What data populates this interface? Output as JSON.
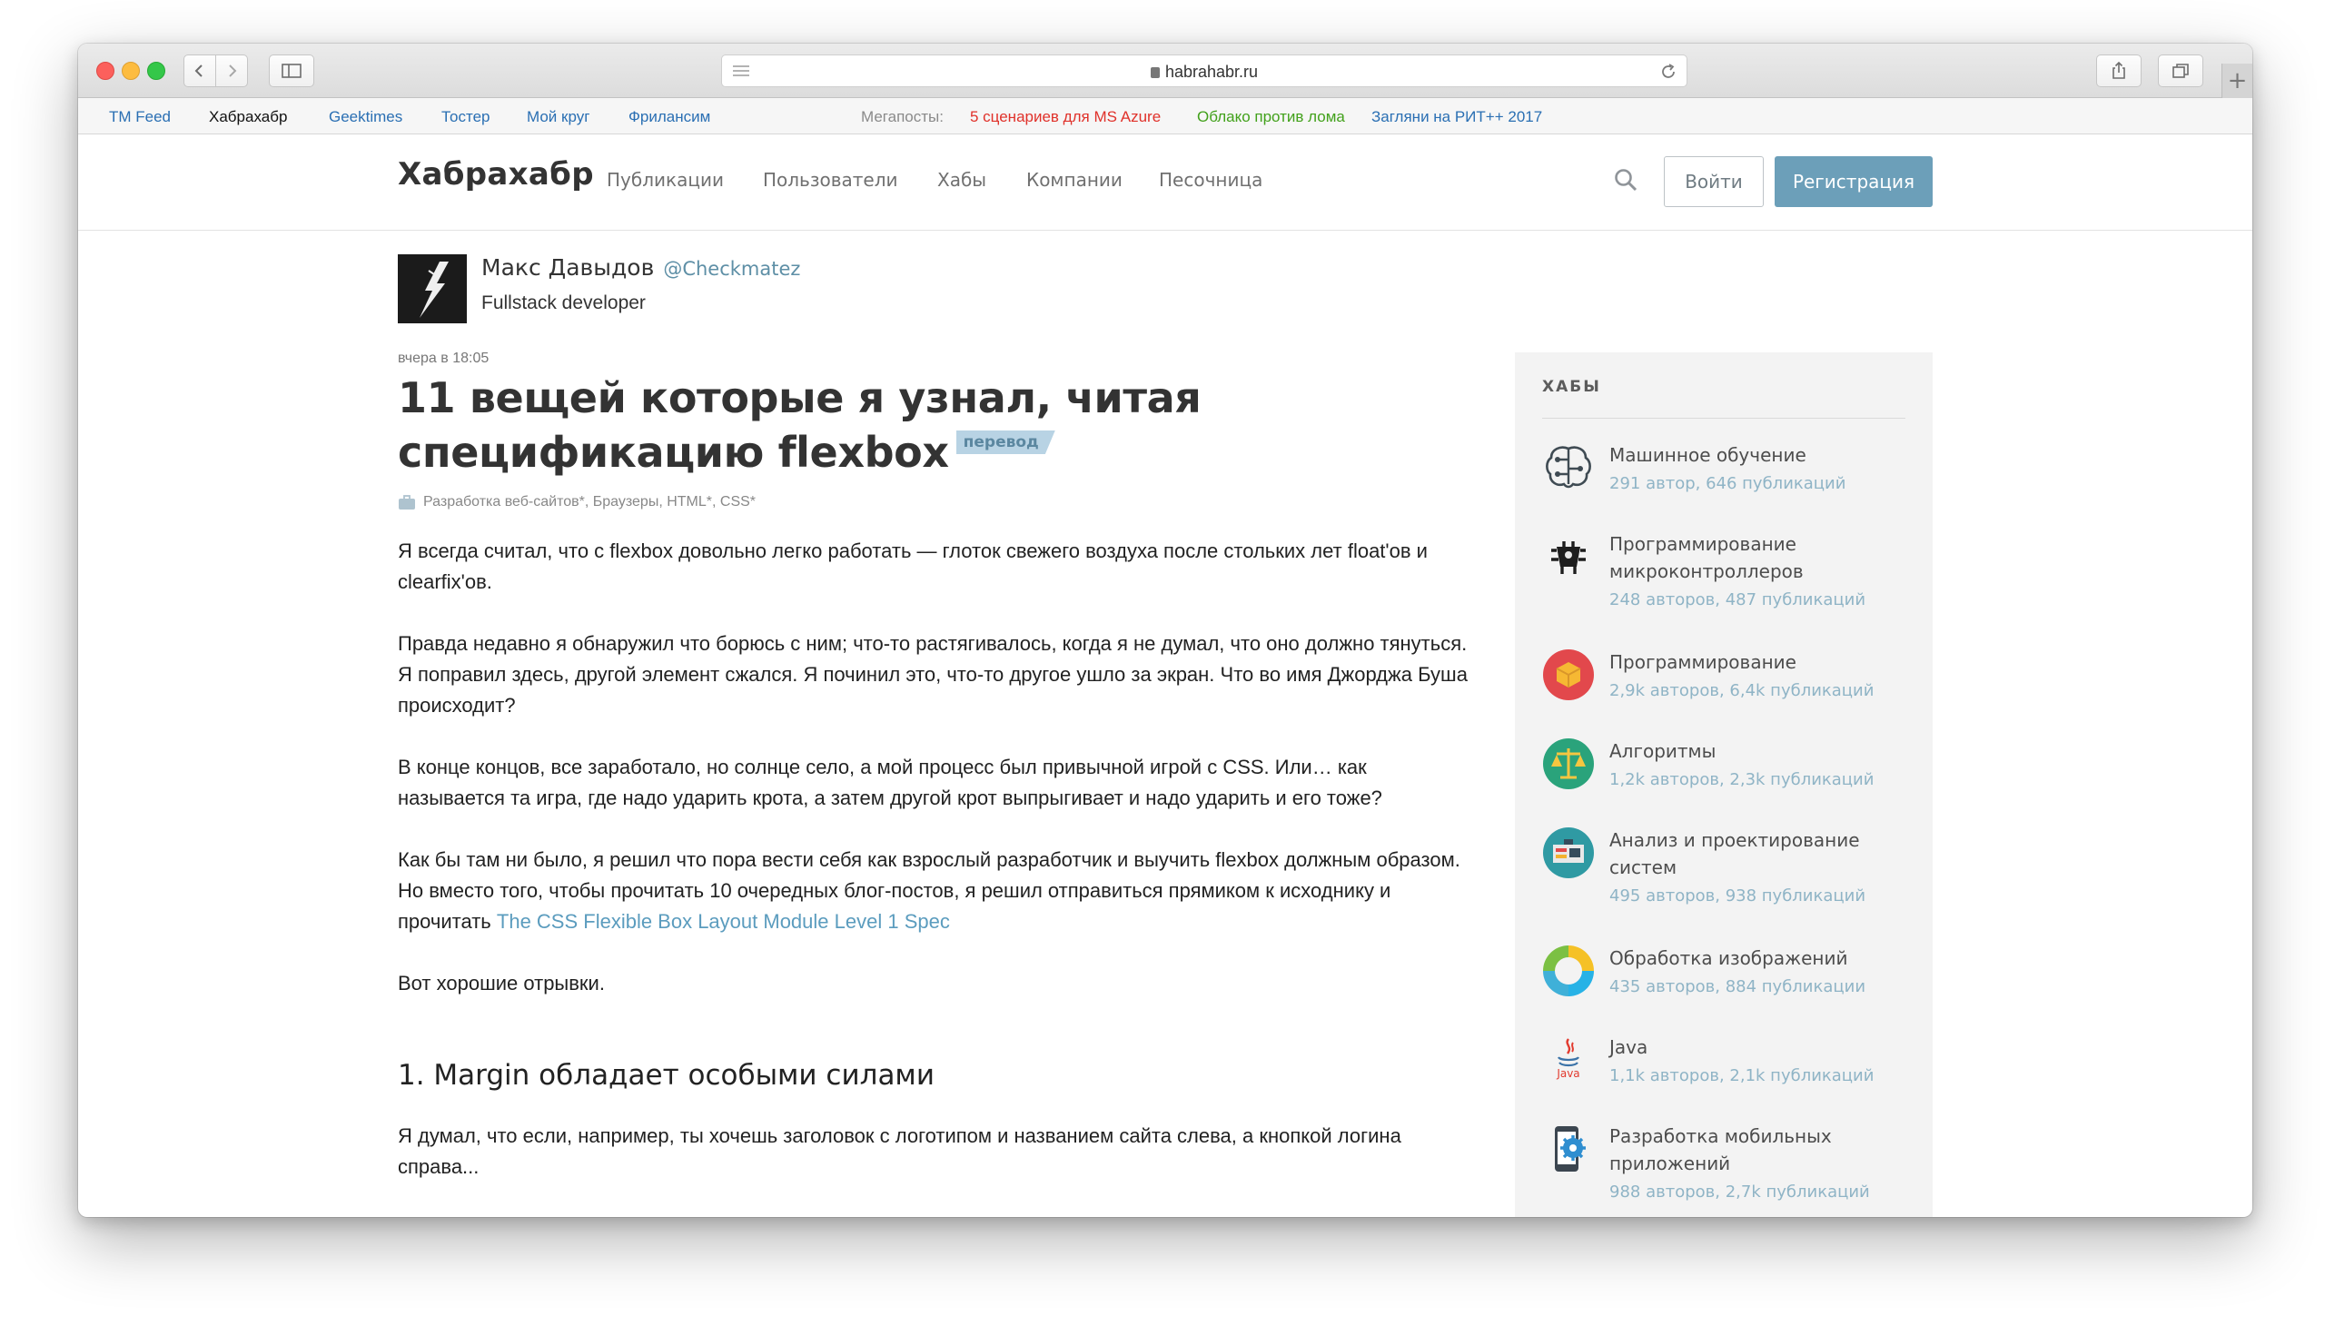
{
  "browser": {
    "url": "habrahabr.ru",
    "icons": [
      "back-icon",
      "forward-icon",
      "sidebar-icon",
      "reader-icon",
      "lock-icon",
      "reload-icon",
      "share-icon",
      "tabs-icon",
      "plus-icon"
    ],
    "newtab": "+"
  },
  "bookmarks": {
    "items": [
      "TM Feed",
      "Хабрахабр",
      "Geektimes",
      "Тостер",
      "Мой круг",
      "Фрилансим"
    ],
    "mega_label": "Мегапосты:",
    "mega": [
      "5 сценариев для MS Azure",
      "Облако против лома",
      "Загляни на РИТ++ 2017"
    ],
    "colors": {
      "link": "#2a6fb3",
      "active": "#111111",
      "mega_label": "#8a8a8a",
      "mega1": "#e0312a",
      "mega2": "#42a11b",
      "mega3": "#2a6fb3"
    }
  },
  "header": {
    "logo": "Хабрахабр",
    "menu": [
      "Публикации",
      "Пользователи",
      "Хабы",
      "Компании",
      "Песочница"
    ],
    "login": "Войти",
    "register": "Регистрация",
    "colors": {
      "register_bg": "#6c9fb9"
    }
  },
  "author": {
    "name": "Макс Давыдов",
    "nick": "@Checkmatez",
    "spec": "Fullstack developer"
  },
  "post": {
    "time": "вчера в 18:05",
    "title": "11 вещей которые я узнал, читая спецификацию flexbox",
    "badge": "перевод",
    "hubs": "Разработка веб-сайтов*, Браузеры, HTML*, CSS*",
    "p1": "Я всегда считал, что с flexbox довольно легко работать — глоток свежего воздуха после стольких лет float'ов и clearfix'ов.",
    "p2": "Правда недавно я обнаружил что борюсь с ним; что-то растягивалось, когда я не думал, что оно должно тянуться. Я поправил здесь, другой элемент сжался. Я починил это, что-то другое ушло за экран. Что во имя Джорджа Буша происходит?",
    "p3": "В конце концов, все заработало, но солнце село, а мой процесс был привычной игрой с CSS. Или… как называется та игра, где надо ударить крота, а затем другой крот выпрыгивает и надо ударить и его тоже?",
    "p4_text": "Как бы там ни было, я решил что пора вести себя как взрослый разработчик и выучить flexbox должным образом. Но вместо того, чтобы прочитать 10 очередных блог-постов, я решил отправиться прямиком к исходнику и прочитать ",
    "p4_link": "The CSS Flexible Box Layout Module Level 1 Spec",
    "p5": "Вот хорошие отрывки.",
    "h2": "1. Margin обладает особыми силами",
    "p6": "Я думал, что если, например, ты хочешь заголовок с логотипом и названием сайта слева, а кнопкой логина справа..."
  },
  "sidebar": {
    "title": "ХАБЫ",
    "hubs": [
      {
        "name": "Машинное обучение",
        "stats": "291 автор, 646 публикаций",
        "icon": "brain-icon"
      },
      {
        "name": "Программирование микроконтроллеров",
        "stats": "248 авторов, 487 публикаций",
        "icon": "chip-icon"
      },
      {
        "name": "Программирование",
        "stats": "2,9k авторов, 6,4k публикаций",
        "icon": "cube-icon"
      },
      {
        "name": "Алгоритмы",
        "stats": "1,2k авторов, 2,3k публикаций",
        "icon": "scales-icon"
      },
      {
        "name": "Анализ и проектирование систем",
        "stats": "495 авторов, 938 публикаций",
        "icon": "blueprint-icon"
      },
      {
        "name": "Обработка изображений",
        "stats": "435 авторов, 884 публикации",
        "icon": "color-ring-icon"
      },
      {
        "name": "Java",
        "stats": "1,1k авторов, 2,1k публикаций",
        "icon": "java-icon"
      },
      {
        "name": "Разработка мобильных приложений",
        "stats": "988 авторов, 2,7k публикаций",
        "icon": "mobile-gear-icon"
      }
    ]
  }
}
